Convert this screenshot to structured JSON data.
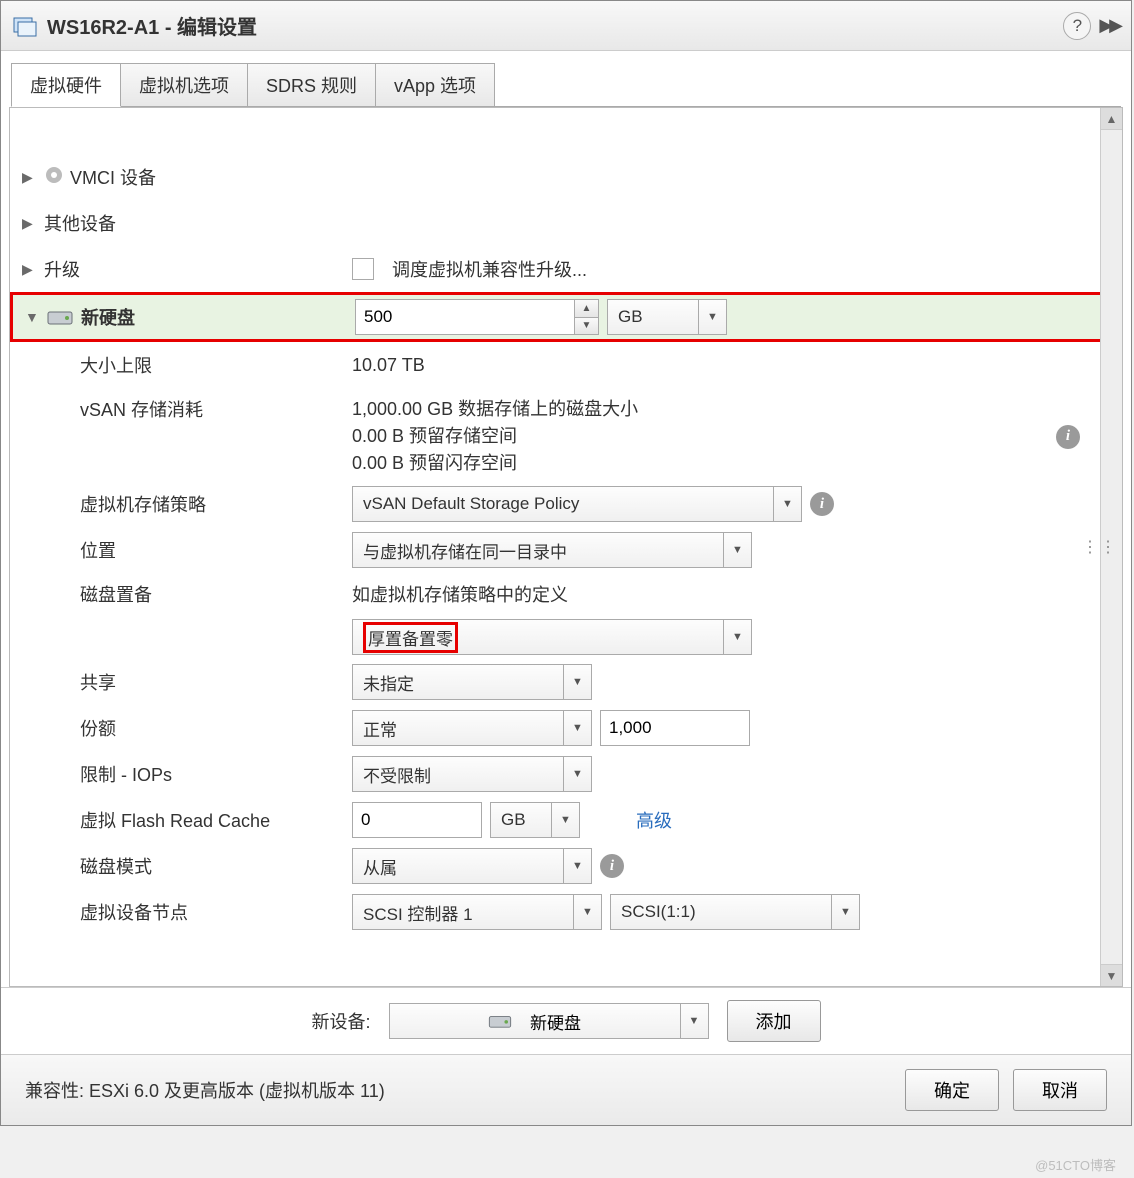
{
  "title": {
    "vm_name": "WS16R2-A1",
    "suffix": " - 编辑设置"
  },
  "tabs": {
    "t0": "虚拟硬件",
    "t1": "虚拟机选项",
    "t2": "SDRS 规则",
    "t3": "vApp 选项"
  },
  "rows": {
    "vmci": "VMCI 设备",
    "other": "其他设备",
    "upgrade": {
      "label": "升级",
      "checkbox_text": "调度虚拟机兼容性升级..."
    },
    "new_disk": {
      "label": "新硬盘",
      "size_value": "500",
      "unit": "GB"
    },
    "max_size": {
      "label": "大小上限",
      "value": "10.07 TB"
    },
    "vsan": {
      "label": "vSAN 存储消耗",
      "line1": "1,000.00 GB 数据存储上的磁盘大小",
      "line2": "0.00 B 预留存储空间",
      "line3": "0.00 B 预留闪存空间"
    },
    "policy": {
      "label": "虚拟机存储策略",
      "value": "vSAN Default Storage Policy"
    },
    "location": {
      "label": "位置",
      "value": "与虚拟机存储在同一目录中"
    },
    "provision": {
      "label": "磁盘置备",
      "text": "如虚拟机存储策略中的定义",
      "value": "厚置备置零"
    },
    "share": {
      "label": "共享",
      "value": "未指定"
    },
    "shares_kv": {
      "label": "份额",
      "value": "正常",
      "num": "1,000"
    },
    "limit": {
      "label": "限制 - IOPs",
      "value": "不受限制"
    },
    "flash": {
      "label": "虚拟 Flash Read Cache",
      "value": "0",
      "unit": "GB",
      "adv": "高级"
    },
    "mode": {
      "label": "磁盘模式",
      "value": "从属"
    },
    "node": {
      "label": "虚拟设备节点",
      "ctrl": "SCSI 控制器 1",
      "addr": "SCSI(1:1)"
    }
  },
  "footer": {
    "new_device_label": "新设备:",
    "new_device_value": "新硬盘",
    "add": "添加",
    "compat": "兼容性: ESXi 6.0 及更高版本 (虚拟机版本 11)",
    "ok": "确定",
    "cancel": "取消"
  },
  "watermark": "@51CTO博客"
}
